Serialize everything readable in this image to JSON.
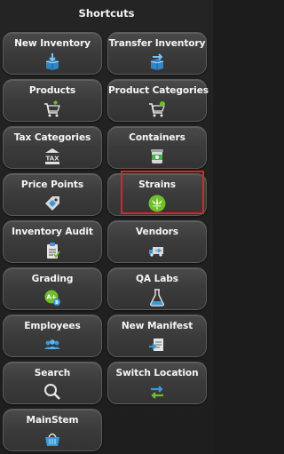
{
  "panel": {
    "title": "Shortcuts"
  },
  "tiles": [
    {
      "label": "New Inventory",
      "icon": "new-inventory-box-icon"
    },
    {
      "label": "Transfer Inventory",
      "icon": "transfer-inventory-box-icon"
    },
    {
      "label": "Products",
      "icon": "products-cart-icon"
    },
    {
      "label": "Product Categories",
      "icon": "product-categories-cart-icon"
    },
    {
      "label": "Tax Categories",
      "icon": "tax-icon",
      "icon_text": "TAX"
    },
    {
      "label": "Containers",
      "icon": "container-can-icon"
    },
    {
      "label": "Price Points",
      "icon": "price-tag-icon"
    },
    {
      "label": "Strains",
      "icon": "cannabis-leaf-icon"
    },
    {
      "label": "Inventory Audit",
      "icon": "clipboard-audit-icon"
    },
    {
      "label": "Vendors",
      "icon": "vendor-truck-icon"
    },
    {
      "label": "Grading",
      "icon": "grade-badge-icon",
      "icon_text": "A+"
    },
    {
      "label": "QA Labs",
      "icon": "flask-icon"
    },
    {
      "label": "Employees",
      "icon": "employees-group-icon"
    },
    {
      "label": "New Manifest",
      "icon": "manifest-arrow-icon"
    },
    {
      "label": "Search",
      "icon": "magnifier-icon"
    },
    {
      "label": "Switch Location",
      "icon": "switch-location-arrows-icon"
    },
    {
      "label": "MainStem",
      "icon": "mainstem-basket-icon"
    }
  ],
  "colors": {
    "background": "#1e1e1e",
    "tile": "#3d3d3d",
    "accent_blue": "#3a9ad9",
    "strains_green": "#6fbf2a",
    "highlight": "#d0282c"
  }
}
